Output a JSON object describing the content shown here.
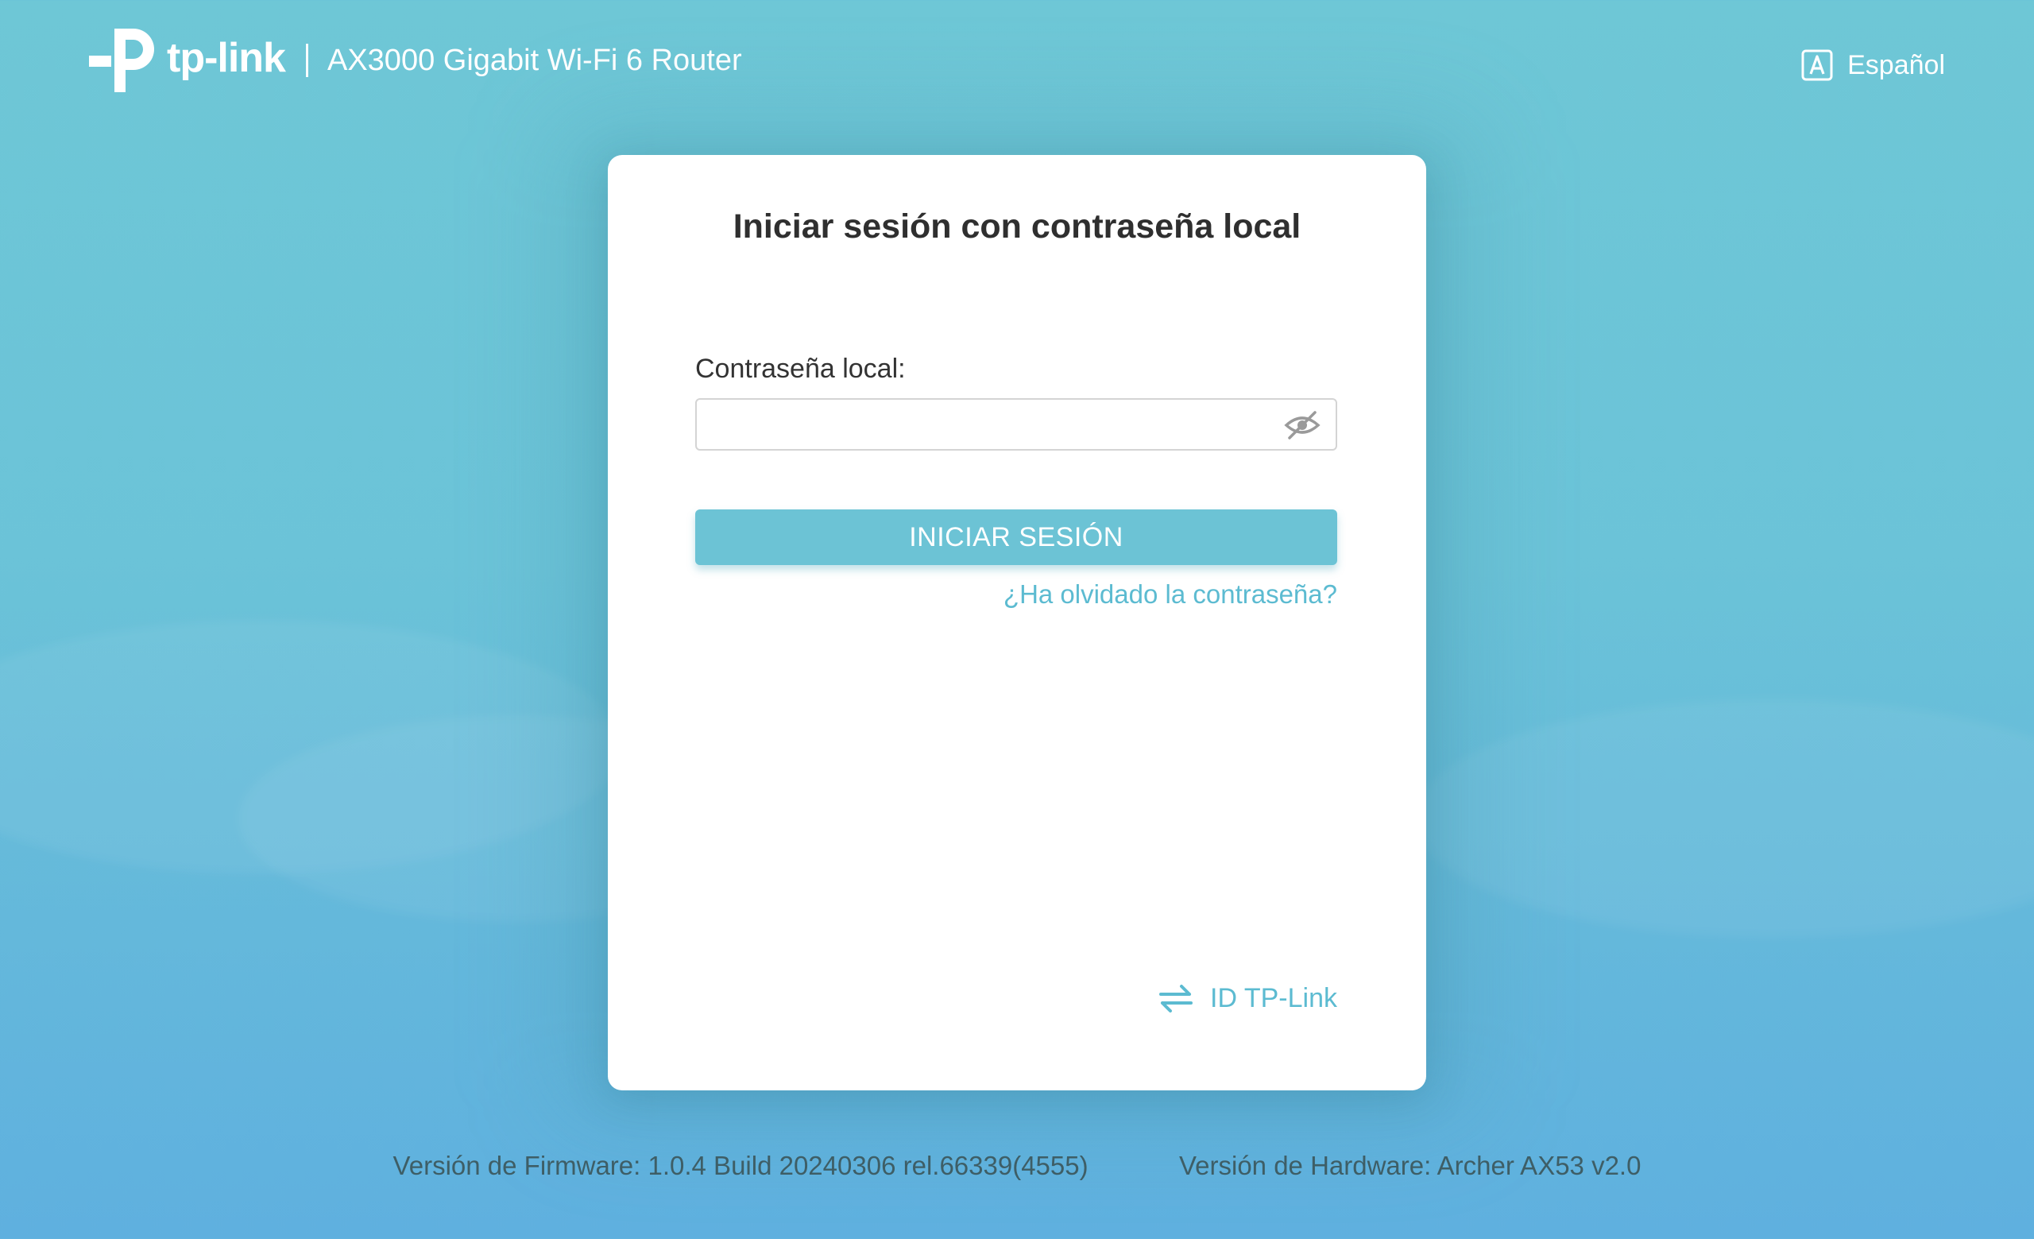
{
  "header": {
    "logo_text": "tp-link",
    "product_name": "AX3000 Gigabit Wi-Fi 6 Router",
    "language": "Español"
  },
  "login": {
    "title": "Iniciar sesión con contraseña local",
    "password_label": "Contraseña local:",
    "password_value": "",
    "login_button": "INICIAR SESIÓN",
    "forgot_link": "¿Ha olvidado la contraseña?",
    "tplink_id_link": "ID TP-Link"
  },
  "footer": {
    "firmware": "Versión de Firmware: 1.0.4 Build 20240306 rel.66339(4555)",
    "hardware": "Versión de Hardware: Archer AX53 v2.0"
  },
  "icons": {
    "logo": "tp-link-logo-icon",
    "language": "language-icon",
    "password_toggle": "eye-slash-icon",
    "switch": "switch-arrows-icon"
  },
  "colors": {
    "background_top": "#6ec7d6",
    "background_bottom": "#5fb0df",
    "accent": "#6cc3d5",
    "link": "#5cbbd1",
    "card": "#ffffff",
    "title_text": "#2f2f2f",
    "footer_text": "#3e5e66"
  }
}
